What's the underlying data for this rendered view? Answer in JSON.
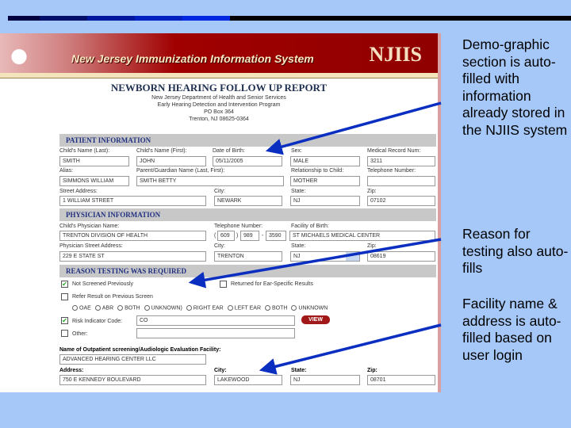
{
  "slide": {
    "notes": [
      "Demo-graphic section is auto-filled with information already stored in the NJIIS system",
      "Reason for testing also auto-fills",
      "Facility name & address is auto-filled based on user login"
    ]
  },
  "colors": {
    "background": "#a6c8f8",
    "banner": "#900000",
    "arrow": "#0a2fc0"
  },
  "app": {
    "title": "New Jersey Immunization Information System",
    "logo": "NJIIS",
    "seal": "NEW JERSEY DEPARTMENT OF HEALTH AND SENIOR SERVICES"
  },
  "report": {
    "title": "NEWBORN HEARING FOLLOW UP REPORT",
    "address": [
      "New Jersey Department of Health and Senior Services",
      "Early Hearing Detection and Intervention Program",
      "PO Box 364",
      "Trenton, NJ 08625-0364"
    ]
  },
  "patient": {
    "header": "PATIENT INFORMATION",
    "last_label": "Child's Name (Last):",
    "last": "SMITH",
    "first_label": "Child's Name (First):",
    "first": "JOHN",
    "dob_label": "Date of Birth:",
    "dob": "05/11/2005",
    "sex_label": "Sex:",
    "sex": "MALE",
    "mrn_label": "Medical Record Num:",
    "mrn": "3211",
    "alias_label": "Alias:",
    "alias": "SIMMONS WILLIAM",
    "parent_label": "Parent/Guardian Name (Last, First):",
    "parent": "SMITH BETTY",
    "rel_label": "Relationship to Child:",
    "rel": "MOTHER",
    "tel_label": "Telephone Number:",
    "tel": "",
    "street_label": "Street Address:",
    "street": "1 WILLIAM STREET",
    "city_label": "City:",
    "city": "NEWARK",
    "state_label": "State:",
    "state": "NJ",
    "zip_label": "Zip:",
    "zip": "07102"
  },
  "physician": {
    "header": "PHYSICIAN INFORMATION",
    "name_label": "Child's Physician Name:",
    "name": "TRENTON DIVISION OF HEALTH",
    "tel_label": "Telephone Number:",
    "area": "609",
    "prefix": "989",
    "line": "3590",
    "fac_label": "Facility of Birth:",
    "facility": "ST MICHAELS MEDICAL CENTER",
    "addr_label": "Physician Street Address:",
    "addr": "229 E STATE ST",
    "city_label": "City:",
    "city": "TRENTON",
    "state_label": "State:",
    "state": "NJ",
    "zip_label": "Zip:",
    "zip": "08619"
  },
  "reason": {
    "header": "REASON TESTING WAS REQUIRED",
    "not_screened": "Not Screened Previously",
    "returned": "Returned for Ear-Specific Results",
    "refer": "Refer Result on Previous Screen",
    "radios": [
      "OAE",
      "ABR",
      "BOTH",
      "UNKNOWN)",
      "RIGHT EAR",
      "LEFT EAR",
      "BOTH",
      "UNKNOWN"
    ],
    "risk": "Risk Indicator Code:",
    "risk_value": "CO",
    "view": "VIEW",
    "other": "Other:"
  },
  "facility": {
    "name_label": "Name of Outpatient screening/Audiologic Evaluation Facility:",
    "name": "ADVANCED HEARING CENTER LLC",
    "addr_label": "Address:",
    "addr": "750 E KENNEDY BOULEVARD",
    "city_label": "City:",
    "city": "LAKEWOOD",
    "state_label": "State:",
    "state": "NJ",
    "zip_label": "Zip:",
    "zip": "08701"
  }
}
